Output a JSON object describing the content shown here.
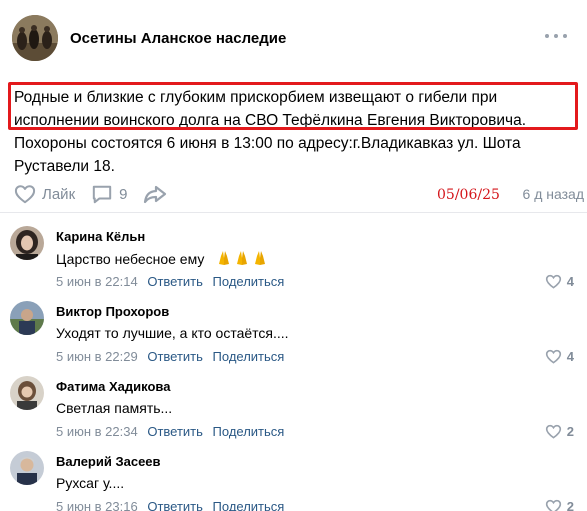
{
  "group": {
    "name": "Осетины Аланское наследие",
    "avatar_icon": "group-avatar-horsemen"
  },
  "post": {
    "lines": [
      "Родные и близкие с глубоким прискорбием извещают о гибели при",
      "исполнении воинского долга на СВО Тефёлкина Евгения Викторовича.",
      "Похороны состоятся 6 июня в 13:00 по адресу:г.Владикавказ ул. Шота",
      "Руставели 18."
    ],
    "highlight_color": "#e3191c"
  },
  "actions": {
    "like_label": "Лайк",
    "comments_count": "9",
    "handwritten_date": "05/06/25",
    "time": "6 д назад"
  },
  "colors": {
    "link": "#2a5885",
    "muted": "#818c99",
    "icon": "#99a2ad"
  },
  "comments": [
    {
      "author": "Карина Кёльн",
      "text": "Царство небесное ему",
      "date": "5 июн в 22:14",
      "reply": "Ответить",
      "share": "Поделиться",
      "likes": "4",
      "emoji": "praying-hands-icon"
    },
    {
      "author": "Виктор Прохоров",
      "text": "Уходят то лучшие, а кто остаётся....",
      "date": "5 июн в 22:29",
      "reply": "Ответить",
      "share": "Поделиться",
      "likes": "4"
    },
    {
      "author": "Фатима Хадикова",
      "text": "Светлая память...",
      "date": "5 июн в 22:34",
      "reply": "Ответить",
      "share": "Поделиться",
      "likes": "2"
    },
    {
      "author": "Валерий Засеев",
      "text": "Рухсаг у....",
      "date": "5 июн в 23:16",
      "reply": "Ответить",
      "share": "Поделиться",
      "likes": "2"
    }
  ]
}
